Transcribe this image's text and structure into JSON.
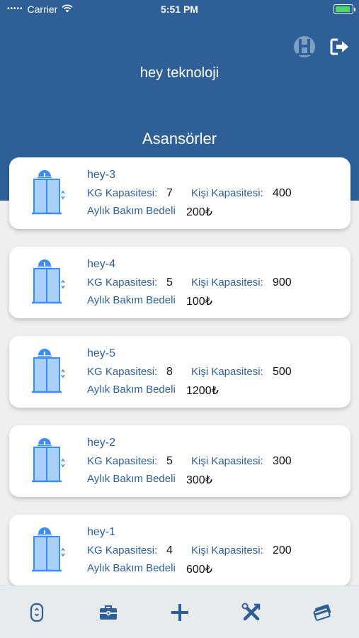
{
  "status": {
    "carrier": "Carrier",
    "time": "5:51 PM"
  },
  "header": {
    "company": "hey teknoloji",
    "section_title": "Asansörler"
  },
  "labels": {
    "kg": "KG Kapasitesi:",
    "kisi": "Kişi Kapasitesi:",
    "bakim": "Aylık Bakım Bedeli"
  },
  "elevators": [
    {
      "name": "hey-3",
      "kg": "7",
      "kisi": "400",
      "bakim": "200₺"
    },
    {
      "name": "hey-4",
      "kg": "5",
      "kisi": "900",
      "bakim": "100₺"
    },
    {
      "name": "hey-5",
      "kg": "8",
      "kisi": "500",
      "bakim": "1200₺"
    },
    {
      "name": "hey-2",
      "kg": "5",
      "kisi": "300",
      "bakim": "300₺"
    },
    {
      "name": "hey-1",
      "kg": "4",
      "kisi": "200",
      "bakim": "600₺"
    }
  ],
  "icons": {
    "header": [
      "elevator-logo-icon",
      "logout-icon"
    ],
    "tabs": [
      "remote-icon",
      "toolbox-icon",
      "plus-icon",
      "tools-icon",
      "cards-icon"
    ]
  },
  "colors": {
    "primary": "#2e5f96",
    "icon_blue": "#3d8df0",
    "background": "#efefef"
  }
}
